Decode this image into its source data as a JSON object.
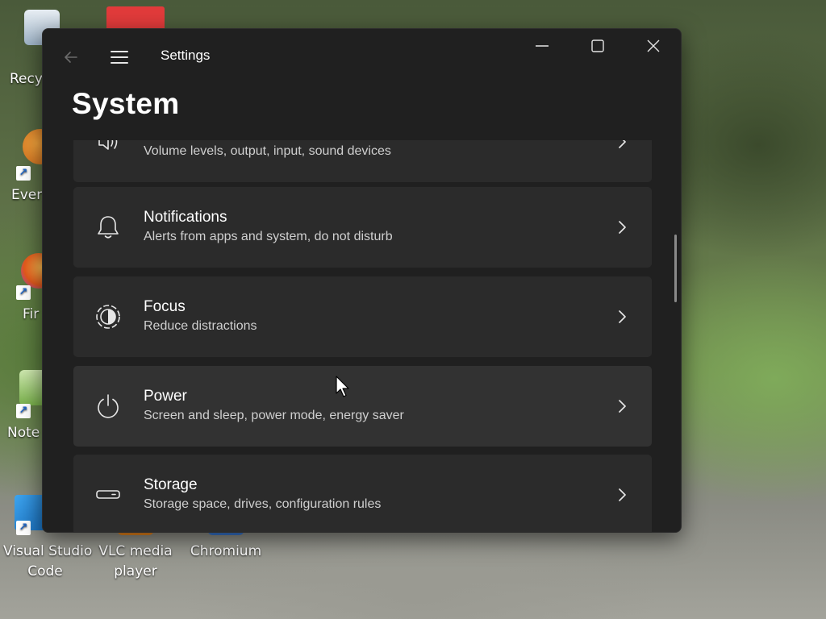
{
  "desktop": {
    "icons": [
      {
        "label": "Recy",
        "icon": "recycle-bin-icon"
      },
      {
        "label": "Every",
        "icon": "everything-icon"
      },
      {
        "label": "Fir",
        "icon": "firefox-icon"
      },
      {
        "label": "Note",
        "icon": "notepad-icon"
      },
      {
        "label_line1": "Visual Studio",
        "label_line2": "Code",
        "icon": "vscode-icon"
      },
      {
        "label_line1": "VLC media",
        "label_line2": "player",
        "icon": "vlc-icon"
      },
      {
        "label": "Chromium",
        "icon": "chromium-icon"
      }
    ]
  },
  "window": {
    "app_title": "Settings",
    "page_title": "System",
    "controls": [
      "minimize-icon",
      "maximize-icon",
      "close-icon"
    ],
    "items": [
      {
        "title": "",
        "subtitle": "Volume levels, output, input, sound devices",
        "icon": "sound-icon"
      },
      {
        "title": "Notifications",
        "subtitle": "Alerts from apps and system, do not disturb",
        "icon": "bell-icon"
      },
      {
        "title": "Focus",
        "subtitle": "Reduce distractions",
        "icon": "focus-icon"
      },
      {
        "title": "Power",
        "subtitle": "Screen and sleep, power mode, energy saver",
        "icon": "power-icon"
      },
      {
        "title": "Storage",
        "subtitle": "Storage space, drives, configuration rules",
        "icon": "storage-icon"
      }
    ]
  },
  "colors": {
    "window_bg": "#202020",
    "card_bg": "#2b2b2b",
    "card_hover_bg": "#323232",
    "text_primary": "#ffffff",
    "text_secondary": "#cfcfcf"
  }
}
